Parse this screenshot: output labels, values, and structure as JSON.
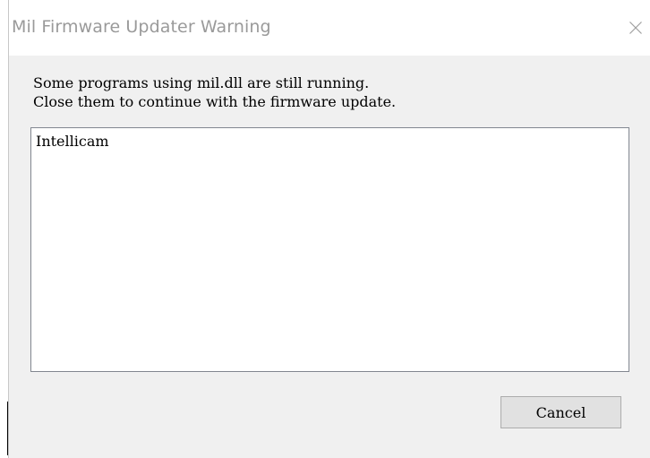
{
  "window": {
    "title": "Mil Firmware Updater Warning",
    "close_icon": "close-icon"
  },
  "message": {
    "line1": "Some programs using mil.dll are still running.",
    "line2": "Close them to continue with the firmware update."
  },
  "program_list": {
    "items": [
      "Intellicam"
    ]
  },
  "buttons": {
    "cancel_label": "Cancel"
  },
  "colors": {
    "title_text": "#9a9a9a",
    "dialog_background": "#f0f0f0",
    "titlebar_background": "#ffffff",
    "button_background": "#e1e1e1",
    "button_border": "#adadad",
    "listbox_border": "#828790"
  }
}
